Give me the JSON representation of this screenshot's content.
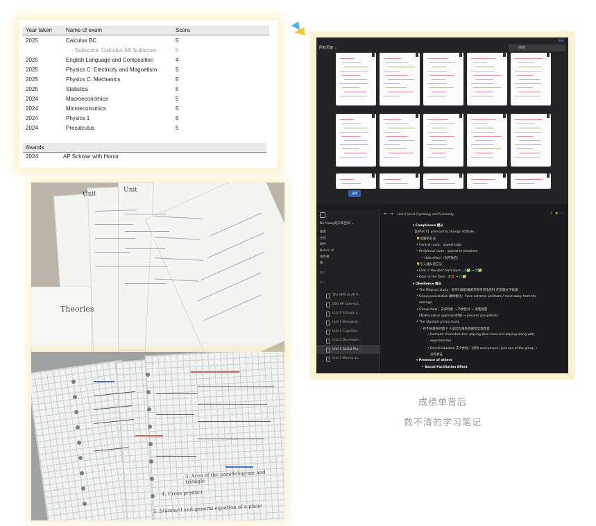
{
  "score_report": {
    "headers": [
      "Year taken",
      "Name of exam",
      "Score"
    ],
    "rows": [
      {
        "year": "2025",
        "exam": "Calculus BC",
        "score": "5"
      },
      {
        "year": "",
        "exam": "- Subscore: Calculus AB Subscore",
        "score": "5",
        "sub": true
      },
      {
        "year": "2025",
        "exam": "English Language and Composition",
        "score": "4"
      },
      {
        "year": "2025",
        "exam": "Physics C: Electricity and Magnetism",
        "score": "5"
      },
      {
        "year": "2025",
        "exam": "Physics C: Mechanics",
        "score": "5"
      },
      {
        "year": "2025",
        "exam": "Statistics",
        "score": "5"
      },
      {
        "year": "2024",
        "exam": "Macroeconomics",
        "score": "5"
      },
      {
        "year": "2024",
        "exam": "Microeconomics",
        "score": "5"
      },
      {
        "year": "2024",
        "exam": "Physics 1",
        "score": "5"
      },
      {
        "year": "2024",
        "exam": "Precalculus",
        "score": "5"
      }
    ],
    "awards_header": "Awards",
    "award": {
      "year": "2024",
      "name": "AP Scholar with Honor"
    }
  },
  "photo_notes": {
    "theories": "Theories",
    "handwriting_1": "3. Area of the parallelogram and triangle",
    "handwriting_2": "4. Cross product",
    "handwriting_3": "5. Standard and general equation of a plane",
    "unit_label": "Unit"
  },
  "gallery": {
    "title": "所有页面 ⌄",
    "search_placeholder": "搜索",
    "corner": "完成",
    "chip": "选择"
  },
  "sidebar": {
    "workspace": "Do Yiroxy的工作空间 ⌄",
    "items": [
      "搜索",
      "主页",
      "收件",
      "Notion AI",
      "收件箱",
      "库"
    ],
    "section_recent": "最近",
    "section_private": "私人",
    "pages": [
      "The VIPS of AP P...",
      "EBQ AP Concepts",
      "Unit 0 Schools o...",
      "Unit 1 Biological...",
      "Unit 2 Cognition",
      "Unit 3 Developm...",
      "Unit 4 Social Psy...",
      "Unit 5 Mental an..."
    ],
    "active_index": 6
  },
  "note": {
    "breadcrumb": "Unit 4 Social Psychology and Personality",
    "lines": [
      "▾ Compliance 顺从",
      "【DIRECT】pressure to change attitude",
      "👇说服的方法",
      "•  Central route：appeal logic",
      "•  Peripheral route：appeal to emotions",
      "– Halo effect（光环效应）",
      "👇引入顺从的方法",
      "•  Foot in the door technique：小✅ → 大✅",
      "•  Door in the Face：大❌ → 小✅",
      "▾ Obedience 服从",
      "•  The Milgram study：老师们被权威要求去惩罚电击时 还是服从于权威",
      "•  Group polarization 群体极化：more extreme positions / more away from the",
      "   average",
      "•  Group think：去评判者 → 不想反对 → 凑着意愿",
      "   [有alternative approach时候 → prevent groupthink]",
      "•  The Stanford prison study",
      "   – 在不同角色的落下 人会因为角色而感觉出现改变",
      "      •  Demand characteristics: playing their roles and playing along with",
      "         experimenter",
      "      •  Deindividuation 去个体化：(因为 anonymous / just one of the group →",
      "         没有责任",
      "▾ Presence of others",
      "   •  Social Facilitation Effect"
    ]
  },
  "captions": {
    "line1": "成绩单背后",
    "line2": "数不清的学习笔记"
  },
  "colors": {
    "card_glow": "#f5e696",
    "tablet_bg": "#f8f3d0",
    "deco_blue": "#4ab0e8",
    "deco_yellow": "#f0c830"
  }
}
